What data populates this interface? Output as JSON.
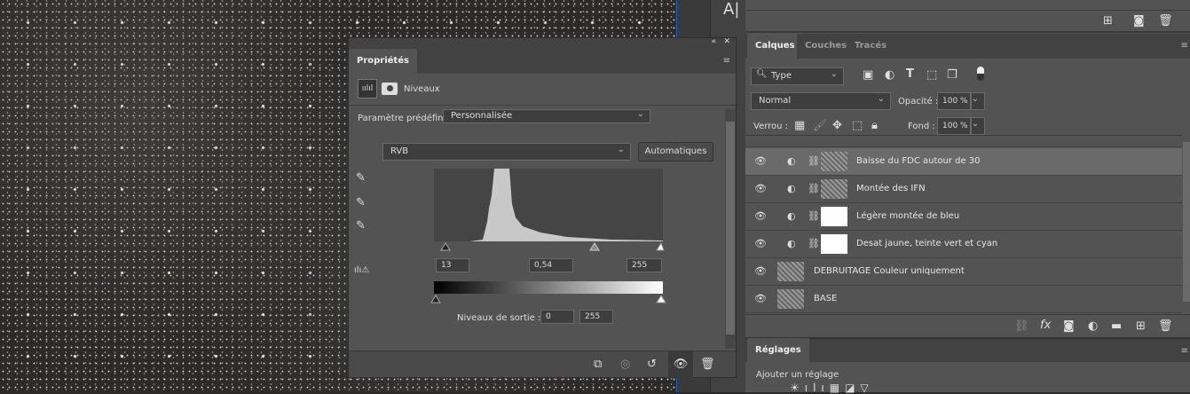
{
  "toolbar": {
    "type_tool": "A|"
  },
  "properties": {
    "tab": "Propriétés",
    "adjustment": "Niveaux",
    "preset_label": "Paramètre prédéfini :",
    "preset_value": "Personnalisée",
    "channel": "RVB",
    "auto_button": "Automatiques",
    "input_black": "13",
    "input_gamma": "0,54",
    "input_white": "255",
    "output_label": "Niveaux de sortie :",
    "output_black": "0",
    "output_white": "255"
  },
  "layers": {
    "tabs": [
      "Calques",
      "Couches",
      "Tracés"
    ],
    "filter": "Type",
    "blend": "Normal",
    "opacity_label": "Opacité :",
    "opacity": "100 %",
    "lock_label": "Verrou :",
    "fill_label": "Fond :",
    "fill": "100 %",
    "items": [
      {
        "name": "Baisse du FDC autour de 30",
        "selected": true
      },
      {
        "name": "Montée des IFN"
      },
      {
        "name": "Légère montée de bleu"
      },
      {
        "name": "Desat jaune, teinte vert et cyan"
      },
      {
        "name": "DEBRUITAGE Couleur uniquement"
      },
      {
        "name": "BASE"
      }
    ]
  },
  "adjustments": {
    "tab": "Réglages",
    "add_label": "Ajouter un réglage"
  }
}
